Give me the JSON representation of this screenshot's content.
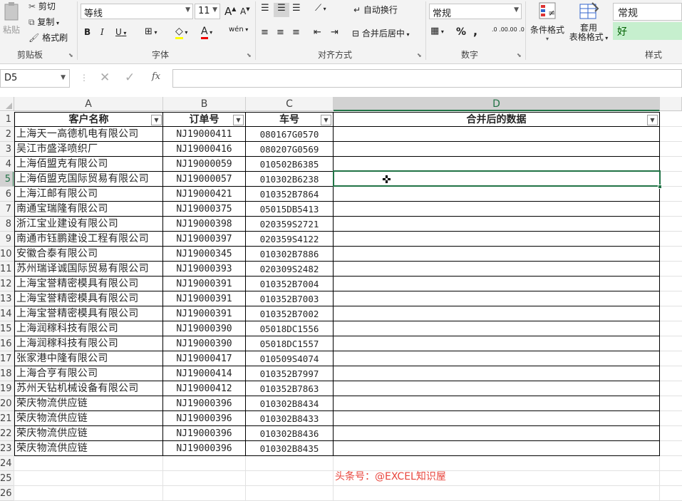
{
  "ribbon": {
    "clipboard": {
      "paste": "粘贴",
      "cut": "剪切",
      "copy": "复制",
      "format_painter": "格式刷",
      "label": "剪贴板"
    },
    "font": {
      "name": "等线",
      "size": "11",
      "label": "字体",
      "bold": "B",
      "italic": "I",
      "underline": "U",
      "grow": "A",
      "shrink": "A",
      "font_color": "A",
      "wen": "wén"
    },
    "alignment": {
      "wrap": "自动换行",
      "merge": "合并后居中",
      "label": "对齐方式"
    },
    "number": {
      "format": "常规",
      "percent": "%",
      "comma": ",",
      "label": "数字",
      "inc_dec": ".0 .00",
      "dec_dec": ".00 .0"
    },
    "styles": {
      "cond_format": "条件格式",
      "table_format_1": "套用",
      "table_format_2": "表格格式",
      "normal": "常规",
      "good": "好",
      "label": "样式"
    }
  },
  "formula_bar": {
    "name_box": "D5",
    "fx": "fx",
    "value": ""
  },
  "columns": [
    "A",
    "B",
    "C",
    "D"
  ],
  "header_row": {
    "a": "客户名称",
    "b": "订单号",
    "c": "车号",
    "d": "合并后的数据"
  },
  "rows": [
    {
      "n": "1"
    },
    {
      "n": "2",
      "a": "上海天一高德机电有限公司",
      "b": "NJ19000411",
      "c": "080167G0570"
    },
    {
      "n": "3",
      "a": "吴江市盛泽喷织厂",
      "b": "NJ19000416",
      "c": "080207G0569"
    },
    {
      "n": "4",
      "a": "上海佰盟克有限公司",
      "b": "NJ19000059",
      "c": "010502B6385"
    },
    {
      "n": "5",
      "a": "上海佰盟克国际贸易有限公司",
      "b": "NJ19000057",
      "c": "010302B6238"
    },
    {
      "n": "6",
      "a": "上海江邮有限公司",
      "b": "NJ19000421",
      "c": "010352B7864"
    },
    {
      "n": "7",
      "a": "南通宝瑞隆有限公司",
      "b": "NJ19000375",
      "c": "05015DB5413"
    },
    {
      "n": "8",
      "a": "浙江宝业建设有限公司",
      "b": "NJ19000398",
      "c": "020359S2721"
    },
    {
      "n": "9",
      "a": "南通市钰鹏建设工程有限公司",
      "b": "NJ19000397",
      "c": "020359S4122"
    },
    {
      "n": "10",
      "a": "安徽合泰有限公司",
      "b": "NJ19000345",
      "c": "010302B7886"
    },
    {
      "n": "11",
      "a": "苏州瑞译诚国际贸易有限公司",
      "b": "NJ19000393",
      "c": "020309S2482"
    },
    {
      "n": "12",
      "a": "上海宝誉精密模具有限公司",
      "b": "NJ19000391",
      "c": "010352B7004"
    },
    {
      "n": "13",
      "a": "上海宝誉精密模具有限公司",
      "b": "NJ19000391",
      "c": "010352B7003"
    },
    {
      "n": "14",
      "a": "上海宝誉精密模具有限公司",
      "b": "NJ19000391",
      "c": "010352B7002"
    },
    {
      "n": "15",
      "a": "上海润稼科技有限公司",
      "b": "NJ19000390",
      "c": "05018DC1556"
    },
    {
      "n": "16",
      "a": "上海润稼科技有限公司",
      "b": "NJ19000390",
      "c": "05018DC1557"
    },
    {
      "n": "17",
      "a": "张家港中隆有限公司",
      "b": "NJ19000417",
      "c": "010509S4074"
    },
    {
      "n": "18",
      "a": "上海合亨有限公司",
      "b": "NJ19000414",
      "c": "010352B7997"
    },
    {
      "n": "19",
      "a": "苏州天钻机械设备有限公司",
      "b": "NJ19000412",
      "c": "010352B7863"
    },
    {
      "n": "20",
      "a": "荣庆物流供应链",
      "b": "NJ19000396",
      "c": "010302B8434"
    },
    {
      "n": "21",
      "a": "荣庆物流供应链",
      "b": "NJ19000396",
      "c": "010302B8433"
    },
    {
      "n": "22",
      "a": "荣庆物流供应链",
      "b": "NJ19000396",
      "c": "010302B8436"
    },
    {
      "n": "23",
      "a": "荣庆物流供应链",
      "b": "NJ19000396",
      "c": "010302B8435"
    },
    {
      "n": "24"
    },
    {
      "n": "25"
    },
    {
      "n": "26"
    }
  ],
  "watermark": "头条号：@EXCEL知识屋",
  "colors": {
    "accent": "#217346",
    "good_bg": "#c6efce",
    "good_fg": "#006100",
    "watermark": "#e8453c"
  }
}
